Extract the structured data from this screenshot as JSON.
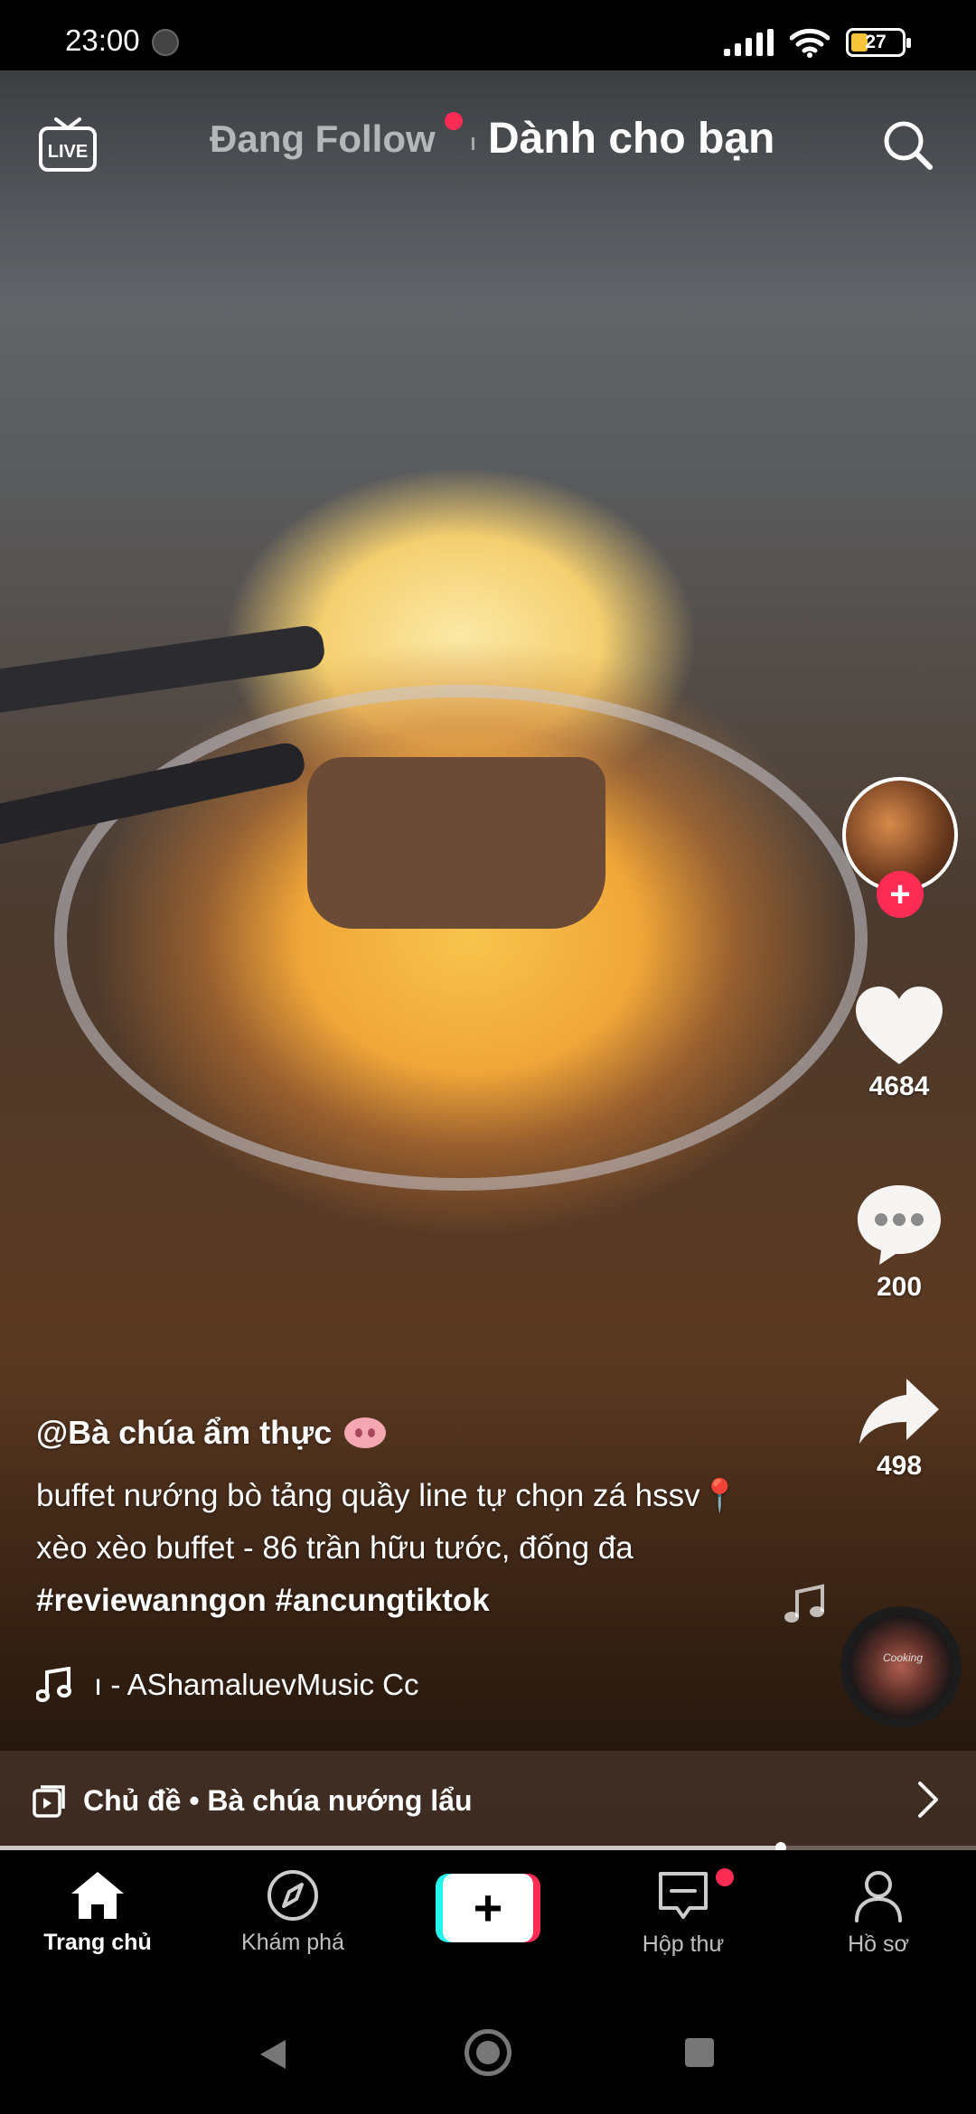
{
  "status_bar": {
    "time": "23:00",
    "battery": "27"
  },
  "top_nav": {
    "following": "Đang Follow",
    "for_you": "Dành cho bạn"
  },
  "right_rail": {
    "likes": "4684",
    "comments": "200",
    "shares": "498",
    "disc_label": "Cooking"
  },
  "caption": {
    "username": "@Bà chúa ẩm thực",
    "description_plain": "buffet nướng bò tảng quầy line tự chọn zá hssv📍xèo xèo buffet - 86 trần hữu tước, đống đa ",
    "hashtags": "#reviewanngon #ancungtiktok",
    "music": "ı - AShamaluevMusic    Cc"
  },
  "topic_bar": {
    "text": "Chủ đề • Bà chúa nướng lẩu"
  },
  "progress": {
    "fraction": 0.8
  },
  "bottom_nav": {
    "home": "Trang chủ",
    "discover": "Khám phá",
    "inbox": "Hộp thư",
    "profile": "Hồ sơ"
  },
  "colors": {
    "accent": "#fe2c55",
    "cyan": "#25f4ee",
    "battery": "#f6c43b"
  },
  "icons": [
    "live-icon",
    "search-icon",
    "heart-icon",
    "comment-icon",
    "share-icon",
    "music-note-icon",
    "topic-icon",
    "chevron-right-icon",
    "home-icon",
    "compass-icon",
    "plus-icon",
    "inbox-icon",
    "profile-icon"
  ]
}
